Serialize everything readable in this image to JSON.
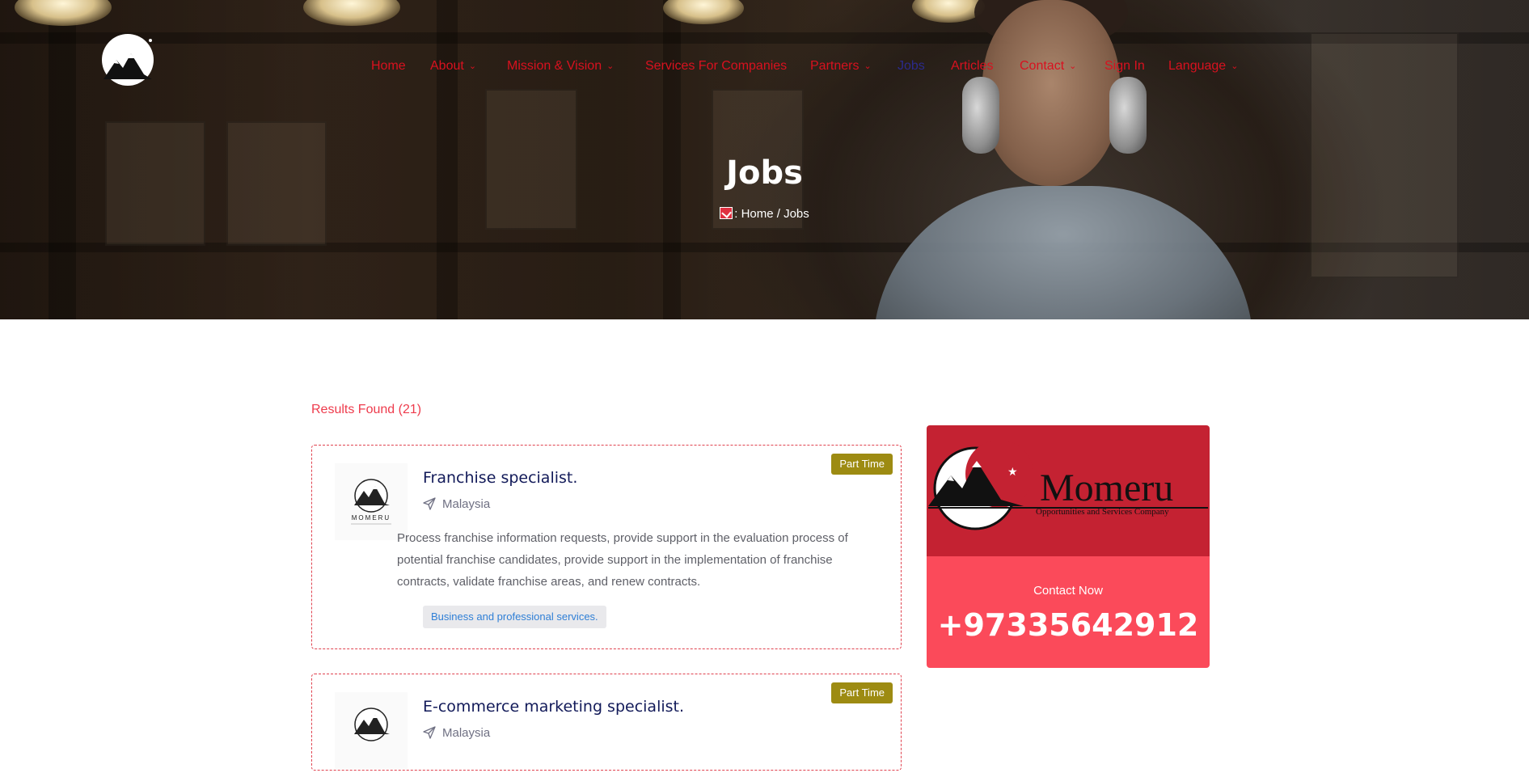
{
  "nav": {
    "items": [
      {
        "label": "Home",
        "has_dropdown": false
      },
      {
        "label": "About",
        "has_dropdown": true
      },
      {
        "label": "Mission & Vision",
        "has_dropdown": true
      },
      {
        "label": "Services For Companies",
        "has_dropdown": false
      },
      {
        "label": "Partners",
        "has_dropdown": true
      },
      {
        "label": "Jobs",
        "has_dropdown": false,
        "active": true
      },
      {
        "label": "Articles",
        "has_dropdown": false
      },
      {
        "label": "Contact",
        "has_dropdown": true
      },
      {
        "label": "Sign In",
        "has_dropdown": false
      },
      {
        "label": "Language",
        "has_dropdown": true
      }
    ]
  },
  "hero": {
    "title": "Jobs",
    "breadcrumb": {
      "sep1": ":",
      "home": "Home",
      "sep2": "/",
      "current": "Jobs"
    }
  },
  "results": {
    "label": "Results Found (21)"
  },
  "jobs": [
    {
      "title": "Franchise specialist.",
      "location": "Malaysia",
      "description": "Process franchise information requests, provide support in the evaluation process of potential franchise candidates, provide support in the implementation of franchise contracts, validate franchise areas, and renew contracts.",
      "category": "Business and professional services.",
      "type": "Part Time"
    },
    {
      "title": "E-commerce marketing specialist.",
      "location": "Malaysia",
      "type": "Part Time"
    }
  ],
  "sidebar": {
    "brand_name": "Momeru",
    "brand_tagline": "Opportunities and Services Company",
    "contact_label": "Contact Now",
    "phone": "+97335642912"
  },
  "colors": {
    "nav_link": "#d9111f",
    "nav_active": "#2b2a8c",
    "accent": "#fb4a5a",
    "badge": "#9d8b12",
    "job_title": "#121a59"
  },
  "icons": {
    "location": "paper-plane-icon",
    "dropdown": "chevron-down-icon",
    "breadcrumb": "home-icon",
    "logo": "mountain-moon-logo"
  }
}
